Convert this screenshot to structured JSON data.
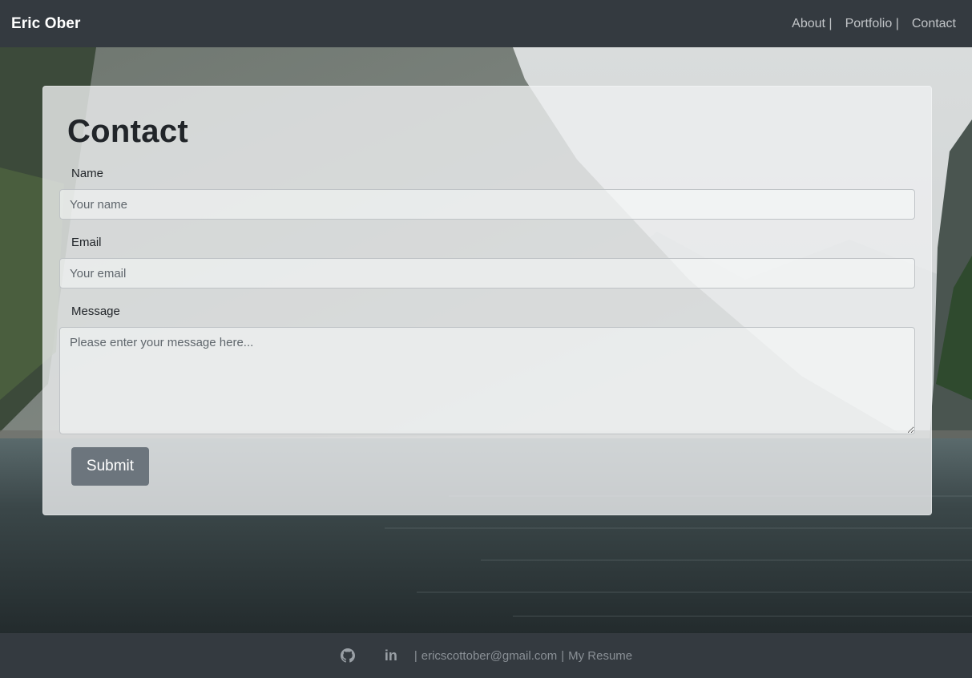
{
  "navbar": {
    "brand": "Eric Ober",
    "links": [
      {
        "label": "About |",
        "icon": null
      },
      {
        "label": "Portfolio |",
        "icon": null
      },
      {
        "label": "Contact",
        "icon": null
      }
    ]
  },
  "contact_form": {
    "title": "Contact",
    "name_label": "Name",
    "name_placeholder": "Your name",
    "email_label": "Email",
    "email_placeholder": "Your email",
    "message_label": "Message",
    "message_placeholder": "Please enter your message here...",
    "submit_label": "Submit"
  },
  "footer": {
    "icons": [
      "github-icon",
      "linkedin-icon"
    ],
    "linkedin_text": "in",
    "email": "ericscottober@gmail.com",
    "resume_label": "My Resume",
    "separator": "|"
  },
  "colors": {
    "navbar_bg": "#343a40",
    "brand_text": "#ffffff",
    "nav_link": "#c2c5c8",
    "button_bg": "#6c757d",
    "footer_text": "#8a9096"
  }
}
